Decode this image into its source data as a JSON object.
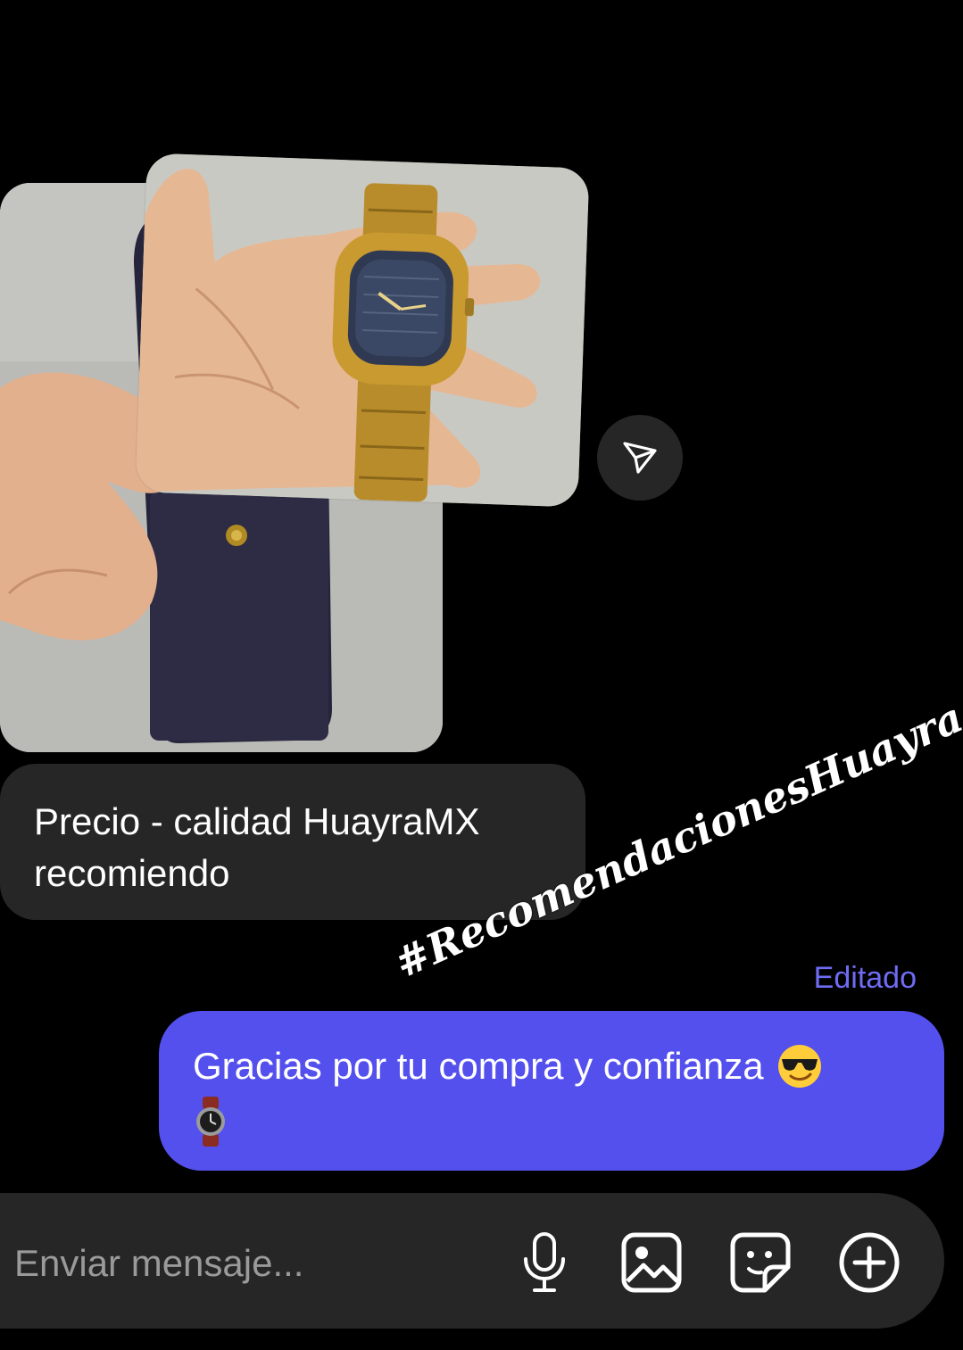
{
  "messages": {
    "received": {
      "line1": "Precio - calidad HuayraMX",
      "line2": "recomiendo"
    },
    "hashtag_sticker": "#RecomendacionesHuayra",
    "edited_label": "Editado",
    "sent": {
      "text": "Gracias por tu compra y confianza"
    }
  },
  "composer": {
    "placeholder": "Enviar mensaje..."
  },
  "icons": {
    "share": "paper-plane-icon",
    "mic": "microphone-icon",
    "gallery": "image-icon",
    "sticker": "sticker-icon",
    "add": "plus-circle-icon"
  },
  "colors": {
    "background": "#000000",
    "received_bubble": "#262626",
    "sent_bubble": "#5450ee",
    "edited_label": "#6f6cf4"
  }
}
